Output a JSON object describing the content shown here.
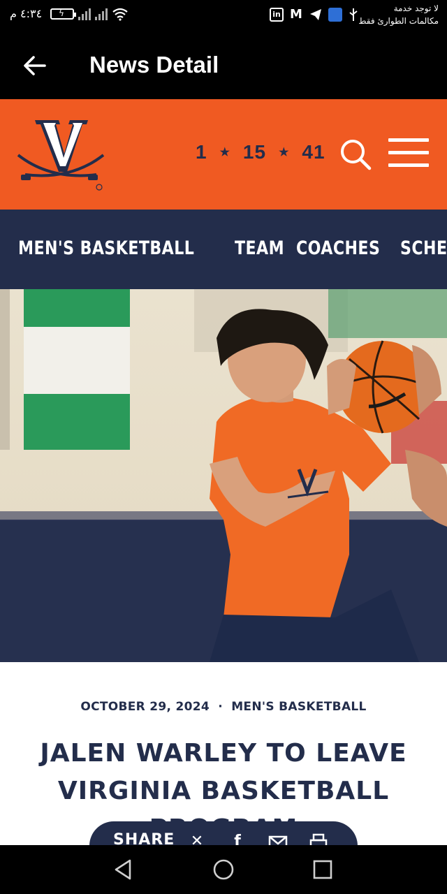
{
  "status_bar": {
    "time": "٤:٣٤ م",
    "carrier_line1": "لا توجد خدمة",
    "carrier_line2": "مكالمات الطوارئ فقط",
    "icons": [
      "battery-icon",
      "signal-icon",
      "signal-icon",
      "wifi-icon",
      "linkedin-icon",
      "gmail-icon",
      "telegram-icon",
      "shield-icon",
      "usb-icon"
    ]
  },
  "app_bar": {
    "title": "News Detail",
    "back_icon": "arrow-left-icon"
  },
  "brand_header": {
    "logo": "virginia-v-sabres-logo",
    "titles": [
      "1",
      "15",
      "41"
    ],
    "title_separator": "★",
    "search_icon": "search-icon",
    "menu_icon": "hamburger-menu-icon"
  },
  "nav": {
    "items": [
      "MEN'S BASKETBALL",
      "TEAM",
      "COACHES",
      "SCHEDULE"
    ]
  },
  "article": {
    "date": "OCTOBER 29, 2024",
    "meta_separator": "·",
    "category": "MEN'S BASKETBALL",
    "headline": "JALEN WARLEY TO LEAVE VIRGINIA BASKETBALL PROGRAM",
    "share_label": "SHARE",
    "share_icons": [
      "x-icon",
      "facebook-icon",
      "email-icon",
      "print-icon"
    ]
  },
  "system_nav": [
    "back-triangle-icon",
    "home-circle-icon",
    "recents-square-icon"
  ],
  "colors": {
    "orange": "#f05a22",
    "navy": "#232d4b",
    "black": "#000000",
    "white": "#ffffff"
  }
}
